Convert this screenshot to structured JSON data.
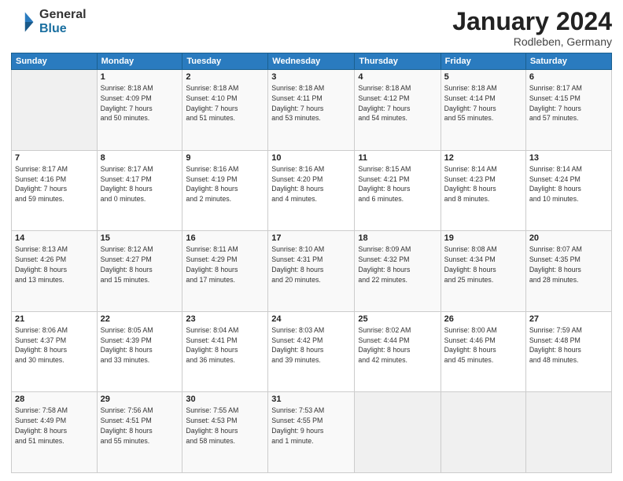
{
  "header": {
    "logo_general": "General",
    "logo_blue": "Blue",
    "title": "January 2024",
    "location": "Rodleben, Germany"
  },
  "weekdays": [
    "Sunday",
    "Monday",
    "Tuesday",
    "Wednesday",
    "Thursday",
    "Friday",
    "Saturday"
  ],
  "weeks": [
    [
      {
        "day": "",
        "detail": ""
      },
      {
        "day": "1",
        "detail": "Sunrise: 8:18 AM\nSunset: 4:09 PM\nDaylight: 7 hours\nand 50 minutes."
      },
      {
        "day": "2",
        "detail": "Sunrise: 8:18 AM\nSunset: 4:10 PM\nDaylight: 7 hours\nand 51 minutes."
      },
      {
        "day": "3",
        "detail": "Sunrise: 8:18 AM\nSunset: 4:11 PM\nDaylight: 7 hours\nand 53 minutes."
      },
      {
        "day": "4",
        "detail": "Sunrise: 8:18 AM\nSunset: 4:12 PM\nDaylight: 7 hours\nand 54 minutes."
      },
      {
        "day": "5",
        "detail": "Sunrise: 8:18 AM\nSunset: 4:14 PM\nDaylight: 7 hours\nand 55 minutes."
      },
      {
        "day": "6",
        "detail": "Sunrise: 8:17 AM\nSunset: 4:15 PM\nDaylight: 7 hours\nand 57 minutes."
      }
    ],
    [
      {
        "day": "7",
        "detail": "Sunrise: 8:17 AM\nSunset: 4:16 PM\nDaylight: 7 hours\nand 59 minutes."
      },
      {
        "day": "8",
        "detail": "Sunrise: 8:17 AM\nSunset: 4:17 PM\nDaylight: 8 hours\nand 0 minutes."
      },
      {
        "day": "9",
        "detail": "Sunrise: 8:16 AM\nSunset: 4:19 PM\nDaylight: 8 hours\nand 2 minutes."
      },
      {
        "day": "10",
        "detail": "Sunrise: 8:16 AM\nSunset: 4:20 PM\nDaylight: 8 hours\nand 4 minutes."
      },
      {
        "day": "11",
        "detail": "Sunrise: 8:15 AM\nSunset: 4:21 PM\nDaylight: 8 hours\nand 6 minutes."
      },
      {
        "day": "12",
        "detail": "Sunrise: 8:14 AM\nSunset: 4:23 PM\nDaylight: 8 hours\nand 8 minutes."
      },
      {
        "day": "13",
        "detail": "Sunrise: 8:14 AM\nSunset: 4:24 PM\nDaylight: 8 hours\nand 10 minutes."
      }
    ],
    [
      {
        "day": "14",
        "detail": "Sunrise: 8:13 AM\nSunset: 4:26 PM\nDaylight: 8 hours\nand 13 minutes."
      },
      {
        "day": "15",
        "detail": "Sunrise: 8:12 AM\nSunset: 4:27 PM\nDaylight: 8 hours\nand 15 minutes."
      },
      {
        "day": "16",
        "detail": "Sunrise: 8:11 AM\nSunset: 4:29 PM\nDaylight: 8 hours\nand 17 minutes."
      },
      {
        "day": "17",
        "detail": "Sunrise: 8:10 AM\nSunset: 4:31 PM\nDaylight: 8 hours\nand 20 minutes."
      },
      {
        "day": "18",
        "detail": "Sunrise: 8:09 AM\nSunset: 4:32 PM\nDaylight: 8 hours\nand 22 minutes."
      },
      {
        "day": "19",
        "detail": "Sunrise: 8:08 AM\nSunset: 4:34 PM\nDaylight: 8 hours\nand 25 minutes."
      },
      {
        "day": "20",
        "detail": "Sunrise: 8:07 AM\nSunset: 4:35 PM\nDaylight: 8 hours\nand 28 minutes."
      }
    ],
    [
      {
        "day": "21",
        "detail": "Sunrise: 8:06 AM\nSunset: 4:37 PM\nDaylight: 8 hours\nand 30 minutes."
      },
      {
        "day": "22",
        "detail": "Sunrise: 8:05 AM\nSunset: 4:39 PM\nDaylight: 8 hours\nand 33 minutes."
      },
      {
        "day": "23",
        "detail": "Sunrise: 8:04 AM\nSunset: 4:41 PM\nDaylight: 8 hours\nand 36 minutes."
      },
      {
        "day": "24",
        "detail": "Sunrise: 8:03 AM\nSunset: 4:42 PM\nDaylight: 8 hours\nand 39 minutes."
      },
      {
        "day": "25",
        "detail": "Sunrise: 8:02 AM\nSunset: 4:44 PM\nDaylight: 8 hours\nand 42 minutes."
      },
      {
        "day": "26",
        "detail": "Sunrise: 8:00 AM\nSunset: 4:46 PM\nDaylight: 8 hours\nand 45 minutes."
      },
      {
        "day": "27",
        "detail": "Sunrise: 7:59 AM\nSunset: 4:48 PM\nDaylight: 8 hours\nand 48 minutes."
      }
    ],
    [
      {
        "day": "28",
        "detail": "Sunrise: 7:58 AM\nSunset: 4:49 PM\nDaylight: 8 hours\nand 51 minutes."
      },
      {
        "day": "29",
        "detail": "Sunrise: 7:56 AM\nSunset: 4:51 PM\nDaylight: 8 hours\nand 55 minutes."
      },
      {
        "day": "30",
        "detail": "Sunrise: 7:55 AM\nSunset: 4:53 PM\nDaylight: 8 hours\nand 58 minutes."
      },
      {
        "day": "31",
        "detail": "Sunrise: 7:53 AM\nSunset: 4:55 PM\nDaylight: 9 hours\nand 1 minute."
      },
      {
        "day": "",
        "detail": ""
      },
      {
        "day": "",
        "detail": ""
      },
      {
        "day": "",
        "detail": ""
      }
    ]
  ]
}
